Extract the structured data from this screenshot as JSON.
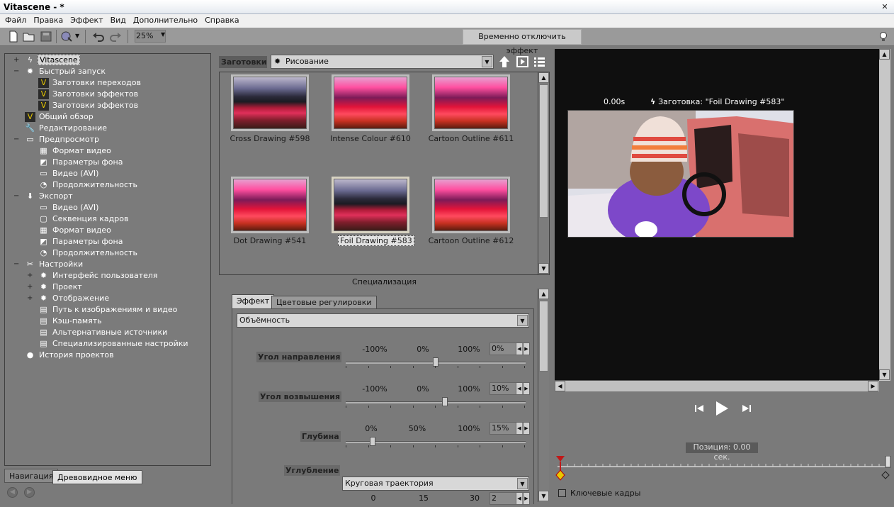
{
  "window": {
    "title": "Vitascene - *"
  },
  "menu": [
    "Файл",
    "Правка",
    "Эффект",
    "Вид",
    "Дополнительно",
    "Справка"
  ],
  "toolbar": {
    "zoom": "25%",
    "disable_effect_label": "Временно отключить эффект"
  },
  "nav": {
    "items": [
      {
        "label": "Vitascene",
        "level": 0,
        "toggle": "+",
        "selected": true
      },
      {
        "label": "Быстрый запуск",
        "level": 0,
        "toggle": "−"
      },
      {
        "label": "Заготовки переходов",
        "level": 1
      },
      {
        "label": "Заготовки эффектов",
        "level": 1
      },
      {
        "label": "Заготовки эффектов",
        "level": 1
      },
      {
        "label": "Общий обзор",
        "level": 0
      },
      {
        "label": "Редактирование",
        "level": 0
      },
      {
        "label": "Предпросмотр",
        "level": 0,
        "toggle": "−"
      },
      {
        "label": "Формат видео",
        "level": 1
      },
      {
        "label": "Параметры фона",
        "level": 1
      },
      {
        "label": "Видео (AVI)",
        "level": 1
      },
      {
        "label": "Продолжительность",
        "level": 1
      },
      {
        "label": "Экспорт",
        "level": 0,
        "toggle": "−"
      },
      {
        "label": "Видео (AVI)",
        "level": 1
      },
      {
        "label": "Секвенция кадров",
        "level": 1
      },
      {
        "label": "Формат видео",
        "level": 1
      },
      {
        "label": "Параметры фона",
        "level": 1
      },
      {
        "label": "Продолжительность",
        "level": 1
      },
      {
        "label": "Настройки",
        "level": 0,
        "toggle": "−"
      },
      {
        "label": "Интерфейс пользователя",
        "level": 1,
        "toggle": "+"
      },
      {
        "label": "Проект",
        "level": 1,
        "toggle": "+"
      },
      {
        "label": "Отображение",
        "level": 1,
        "toggle": "+"
      },
      {
        "label": "Путь к изображениям и видео",
        "level": 1
      },
      {
        "label": "Кэш-память",
        "level": 1
      },
      {
        "label": "Альтернативные источники",
        "level": 1
      },
      {
        "label": "Специализированные настройки",
        "level": 1
      },
      {
        "label": "История проектов",
        "level": 0
      }
    ],
    "tabs": [
      "Навигация",
      "Древовидное меню"
    ]
  },
  "presets": {
    "label": "Заготовки",
    "category": "Рисование",
    "thumbnails": [
      {
        "label": "Cross Drawing #598"
      },
      {
        "label": "Intense Colour #610"
      },
      {
        "label": "Cartoon Outline #611"
      },
      {
        "label": "Dot Drawing #541"
      },
      {
        "label": "Foil Drawing #583",
        "selected": true
      },
      {
        "label": "Cartoon Outline #612"
      }
    ],
    "specialization": "Специализация"
  },
  "effect": {
    "tabs": [
      "Эффект",
      "Цветовые регулировки"
    ],
    "mode": "Объёмность",
    "params": [
      {
        "label": "Угол направления",
        "ticks": [
          "-100%",
          "0%",
          "100%"
        ],
        "value": "0%",
        "level": 0.5
      },
      {
        "label": "Угол возвышения",
        "ticks": [
          "-100%",
          "0%",
          "100%"
        ],
        "value": "10%",
        "level": 0.55
      },
      {
        "label": "Глубина",
        "ticks": [
          "0%",
          "50%",
          "100%"
        ],
        "value": "15%",
        "level": 0.15
      }
    ],
    "relief_label": "Углубление",
    "relief_value": "Круговая траектория",
    "last_ticks": [
      "0",
      "15",
      "30"
    ],
    "last_value": "2"
  },
  "preview": {
    "time": "0.00s",
    "preset_name": "Заготовка: \"Foil Drawing #583\"",
    "position": "Позиция: 0.00 сек.",
    "keyframes_label": "Ключевые кадры"
  },
  "colors": {
    "accent": "#c01818",
    "keyframe": "#e8c800"
  }
}
